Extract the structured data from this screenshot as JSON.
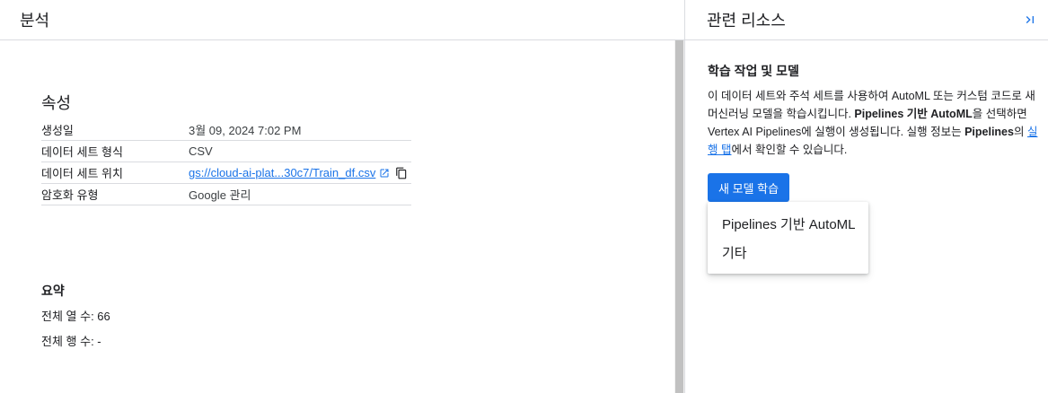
{
  "left": {
    "header_title": "분석",
    "properties_title": "속성",
    "properties": [
      {
        "key": "생성일",
        "value": "3월 09, 2024 7:02 PM"
      },
      {
        "key": "데이터 세트 형식",
        "value": "CSV"
      },
      {
        "key": "데이터 세트 위치",
        "value": "gs://cloud-ai-plat...30c7/Train_df.csv"
      },
      {
        "key": "암호화 유형",
        "value": "Google 관리"
      }
    ],
    "summary_title": "요약",
    "summary_columns": "전체 열 수: 66",
    "summary_rows": "전체 행 수: -"
  },
  "right": {
    "header_title": "관련 리소스",
    "section_heading": "학습 작업 및 모델",
    "desc": {
      "p1": "이 데이터 세트와 주석 세트를 사용하여 AutoML 또는 커스텀 코드로 새 머신러닝 모델을 학습시킵니다. ",
      "b1": "Pipelines 기반 AutoML",
      "p2": "을 선택하면 Vertex AI Pipelines에 실행이 생성됩니다. 실행 정보는 ",
      "b2": "Pipelines",
      "p3": "의 ",
      "link": "실행 탭",
      "p4": "에서 확인할 수 있습니다."
    },
    "train_button": "새 모델 학습",
    "menu_items": [
      "Pipelines 기반 AutoML",
      "기타"
    ]
  },
  "colors": {
    "accent": "#1a73e8",
    "divider": "#dadce0"
  },
  "icons": {
    "collapse": "last-page-icon",
    "external": "open-in-new-icon",
    "copy": "copy-icon"
  }
}
